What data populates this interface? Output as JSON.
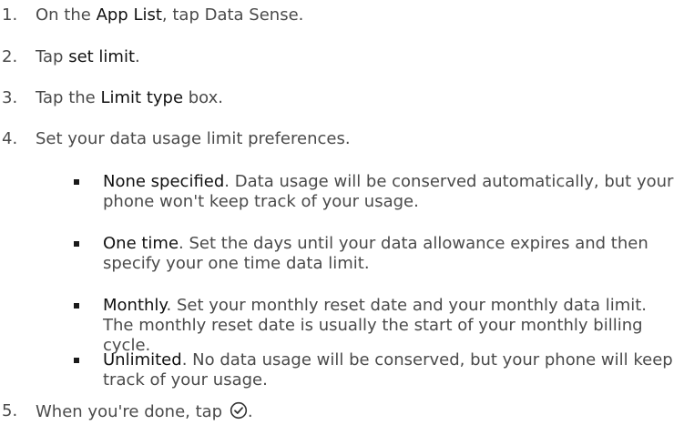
{
  "steps": [
    {
      "num": "1.",
      "pre": "On the ",
      "em": "App List",
      "post": ", tap Data Sense."
    },
    {
      "num": "2.",
      "pre": "Tap ",
      "em": "set limit",
      "post": "."
    },
    {
      "num": "3.",
      "pre": "Tap the ",
      "em": "Limit type",
      "post": " box."
    },
    {
      "num": "4.",
      "text": "Set your data usage limit preferences."
    },
    {
      "num": "5.",
      "pre": "When you're done, tap ",
      "post": ".",
      "icon": "checkmark-circle-icon"
    }
  ],
  "options": [
    {
      "em": "None specified",
      "text": ". Data usage will be conserved automatically, but your phone won't keep track of your usage."
    },
    {
      "em": "One time",
      "text": ". Set the days until your data allowance expires and then specify your one time data limit."
    },
    {
      "em": "Monthly",
      "text": ". Set your monthly reset date and your monthly data limit. The monthly reset date is usually the start of your monthly billing cycle."
    },
    {
      "em": "Unlimited",
      "text": ". No data usage will be conserved, but your phone will keep track of your usage."
    }
  ]
}
